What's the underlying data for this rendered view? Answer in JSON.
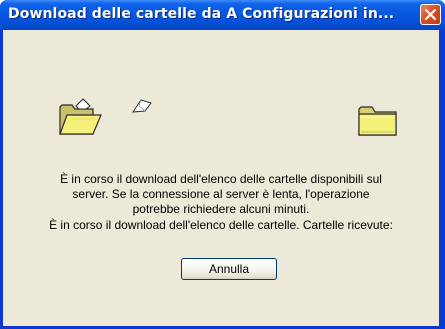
{
  "window": {
    "title": "Download delle cartelle da A Configurazioni in..."
  },
  "message": {
    "line1": "È in corso il download dell'elenco delle cartelle disponibili sul",
    "line2": "server. Se la connessione al server è lenta, l'operazione",
    "line3": "potrebbe richiedere alcuni minuti.",
    "status_label": "È in corso il download dell'elenco delle cartelle. Cartelle ricevute:",
    "status_count": ""
  },
  "buttons": {
    "cancel_label": "Annulla"
  },
  "icons": {
    "close": "close-icon",
    "source_folder": "open-folder-icon",
    "flying_document": "flying-document-icon",
    "destination_folder": "closed-folder-icon"
  },
  "colors": {
    "titlebar": "#0553d8",
    "client_background": "#ece9d8",
    "close_button": "#d9502a",
    "folder_fill": "#f5f07a"
  }
}
